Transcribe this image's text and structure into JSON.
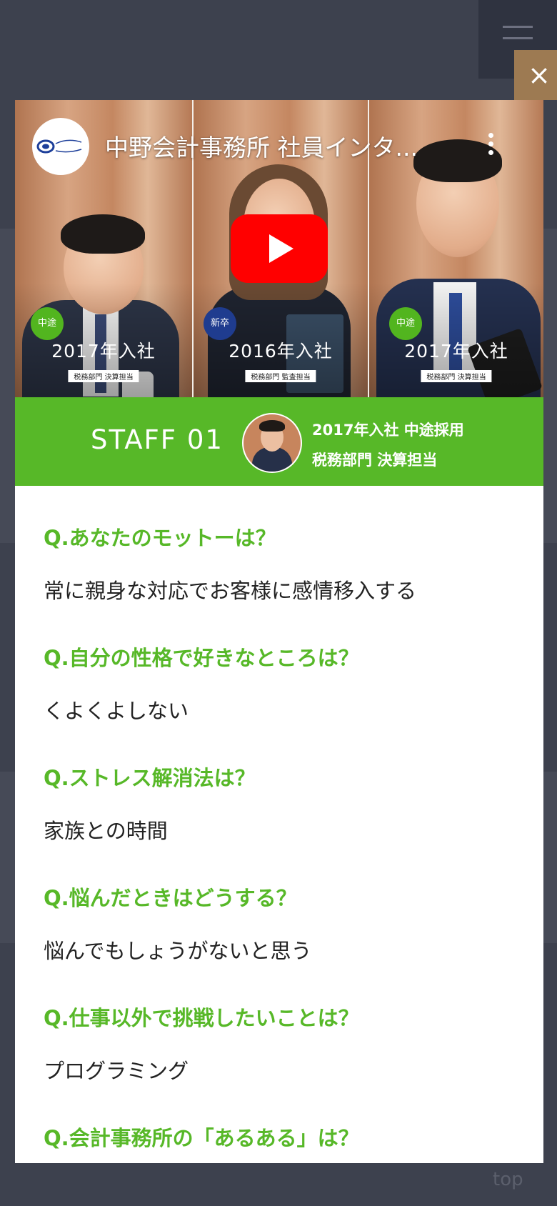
{
  "video": {
    "title": "中野会計事務所 社員インタ...",
    "panels": [
      {
        "badge": "中途",
        "year": "2017年入社",
        "dept": "税務部門 決算担当"
      },
      {
        "badge": "新卒",
        "year": "2016年入社",
        "dept": "税務部門 監査担当"
      },
      {
        "badge": "中途",
        "year": "2017年入社",
        "dept": "税務部門 決算担当"
      }
    ]
  },
  "staff": {
    "title": "STAFF 01",
    "info_line1": "2017年入社 中途採用",
    "info_line2": "税務部門 決算担当"
  },
  "qa": [
    {
      "q": "Q.あなたのモットーは？",
      "a": "常に親身な対応でお客様に感情移入する"
    },
    {
      "q": "Q.自分の性格で好きなところは？",
      "a": "くよくよしない"
    },
    {
      "q": "Q.ストレス解消法は？",
      "a": "家族との時間"
    },
    {
      "q": "Q.悩んだときはどうする？",
      "a": "悩んでもしょうがないと思う"
    },
    {
      "q": "Q.仕事以外で挑戦したいことは？",
      "a": "プログラミング"
    },
    {
      "q": "Q.会計事務所の「あるある」は？",
      "a": ""
    }
  ],
  "close_label": "×",
  "top_label": "top",
  "colors": {
    "accent": "#57b828",
    "close": "#9d7a52",
    "overlay": "#3d414e"
  }
}
